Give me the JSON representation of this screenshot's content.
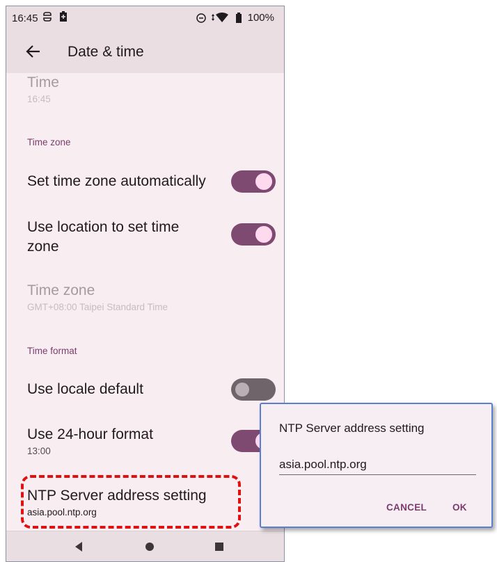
{
  "status_bar": {
    "time": "16:45",
    "battery": "100%"
  },
  "app_bar": {
    "title": "Date & time"
  },
  "settings": {
    "time": {
      "label": "Time",
      "value": "16:45"
    },
    "time_zone_section": "Time zone",
    "set_time_zone_auto": {
      "label": "Set time zone automatically",
      "enabled": true
    },
    "use_location": {
      "label_line1": "Use location to set time",
      "label_line2": "zone",
      "enabled": true
    },
    "time_zone": {
      "label": "Time zone",
      "value": "GMT+08:00 Taipei Standard Time"
    },
    "time_format_section": "Time format",
    "use_locale_default": {
      "label": "Use locale default",
      "enabled": false
    },
    "use_24_hour": {
      "label": "Use 24-hour format",
      "value": "13:00",
      "enabled": true
    },
    "ntp_server": {
      "label": "NTP Server address setting",
      "value": "asia.pool.ntp.org"
    }
  },
  "dialog": {
    "title": "NTP Server address setting",
    "input_value": "asia.pool.ntp.org",
    "cancel_label": "CANCEL",
    "ok_label": "OK"
  },
  "colors": {
    "accent": "#7b3c6d",
    "switch_on": "#7f4a72",
    "highlight": "#e11010",
    "dialog_border": "#5a7fd0"
  },
  "icons": [
    "sim-icon",
    "battery-saver-icon",
    "do-not-disturb-icon",
    "wifi-icon",
    "battery-icon",
    "back-arrow-icon",
    "nav-back-icon",
    "nav-home-icon",
    "nav-recents-icon"
  ]
}
